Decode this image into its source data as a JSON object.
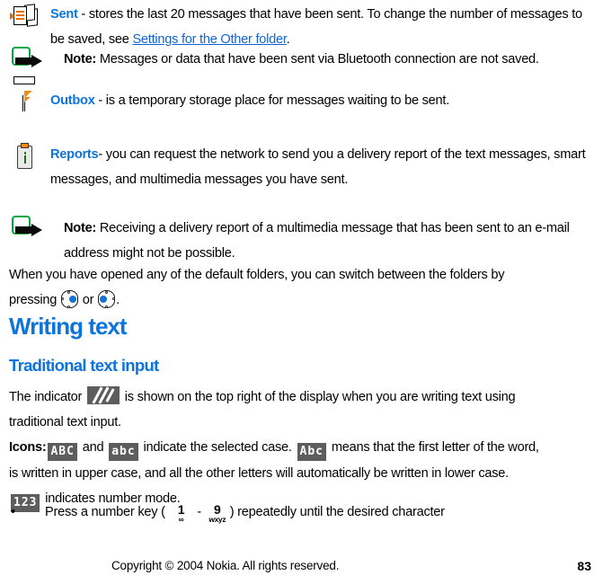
{
  "document": {
    "title": "Nokia user guide page 83 — Messaging folders and Writing text",
    "accent_blue": "#0d74de",
    "link_blue": "#1064d8",
    "icon_magenta": "#e800e8",
    "icon_green": "#00a844",
    "chip_gray": "#5d5d5d"
  },
  "blocks": {
    "sent": {
      "icon_name": "sent-folder-icon",
      "term": "Sent",
      "text_before_link": " - stores the last 20 messages that have been sent. To change the number of messages to be saved, see ",
      "link_text": "Settings for the Other folder",
      "text_after_link": "."
    },
    "note_bluetooth": {
      "icon_name": "note-arrow-icon",
      "label": "Note:",
      "text": "  Messages or data that have been sent via Bluetooth connection are not saved."
    },
    "outbox": {
      "icon_name": "outbox-folder-icon",
      "term": "Outbox",
      "text": " - is a temporary storage place for messages waiting to be sent."
    },
    "reports": {
      "icon_name": "reports-folder-icon",
      "term": "Reports",
      "text": "- you can request the network to send you a delivery report of the text messages, smart messages, and multimedia messages you have sent."
    },
    "note_delivery": {
      "icon_name": "note-arrow-icon",
      "label": "Note:",
      "text": "  Receiving a delivery report of a multimedia message that has been sent to an e-mail address might not be possible."
    },
    "switch_folders": {
      "text_part_1": "When you have opened any of the default folders, you can switch between the folders by pressing ",
      "nav_right_icon_name": "joystick-scroll-right-icon",
      "text_part_2": " or ",
      "nav_left_icon_name": "joystick-scroll-left-icon",
      "text_part_3": "."
    }
  },
  "headings": {
    "writing_text": "Writing text",
    "traditional_text_input": "Traditional text input"
  },
  "indicator_para": {
    "text_part_1": "The indicator ",
    "chip_name": "traditional-text-input-indicator",
    "text_part_2": " is shown on the top right of the display when you are writing text using traditional text input."
  },
  "icons_para": {
    "label": "Icons:",
    "chip_abc_upper": "ABC",
    "text_1": " and ",
    "chip_abc_lower": "abc",
    "text_2": " indicate the selected case. ",
    "chip_abc_mixed": "Abc",
    "text_3": " means that the first letter of the word, is written in upper case, and all the other letters will automatically be written in lower case. ",
    "chip_123": "123",
    "text_4": " indicates number mode."
  },
  "bullet": {
    "marker": "•",
    "text_1": "Press a number key ( ",
    "key_1_digit": "1",
    "key_1_sub": "∞",
    "text_2": " - ",
    "key_9_digit": "9",
    "key_9_sub": "wxyz",
    "text_3": ") repeatedly until the desired character"
  },
  "footer": {
    "copyright": "Copyright © 2004 Nokia. All rights reserved.",
    "page_number": "83"
  }
}
